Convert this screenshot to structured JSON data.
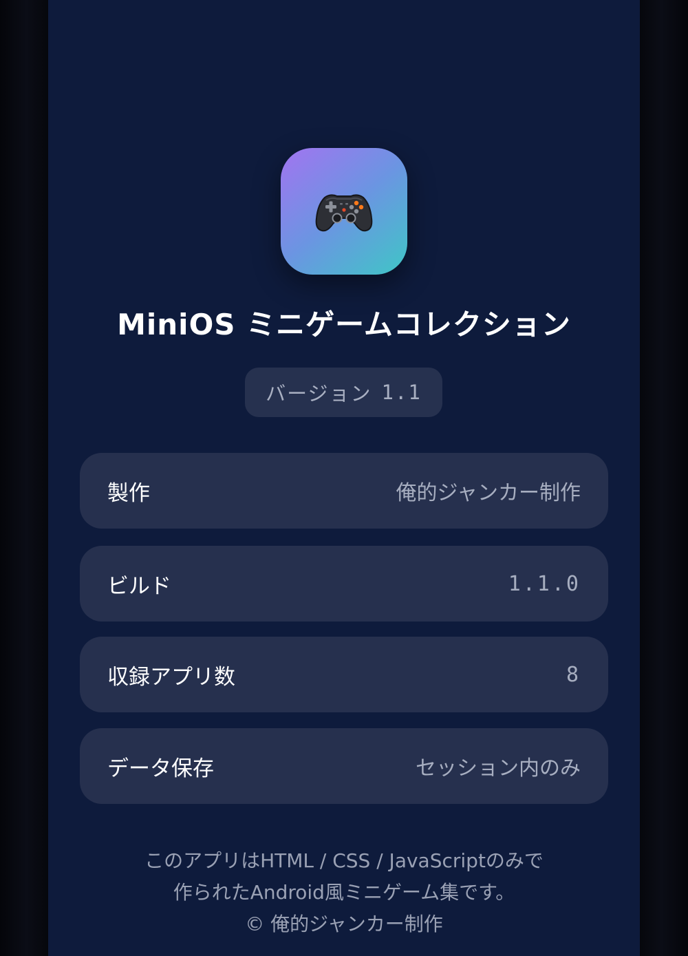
{
  "app": {
    "icon": "game-controller-icon",
    "title": "MiniOS ミニゲームコレクション",
    "version_label": "バージョン",
    "version_number": "1.1"
  },
  "info_rows": [
    {
      "label": "製作",
      "value": "俺的ジャンカー制作"
    },
    {
      "label": "ビルド",
      "value": "1.1.0"
    },
    {
      "label": "収録アプリ数",
      "value": "8"
    },
    {
      "label": "データ保存",
      "value": "セッション内のみ"
    }
  ],
  "footer": {
    "line1": "このアプリはHTML / CSS / JavaScriptのみで",
    "line2": "作られたAndroid風ミニゲーム集です。",
    "line3": "© 俺的ジャンカー制作"
  },
  "colors": {
    "background": "#0e1b3c",
    "card": "#26304e",
    "icon_gradient_start": "#a274f0",
    "icon_gradient_end": "#3fc6c6",
    "text_primary": "#ffffff",
    "text_secondary": "#a7aec0"
  }
}
